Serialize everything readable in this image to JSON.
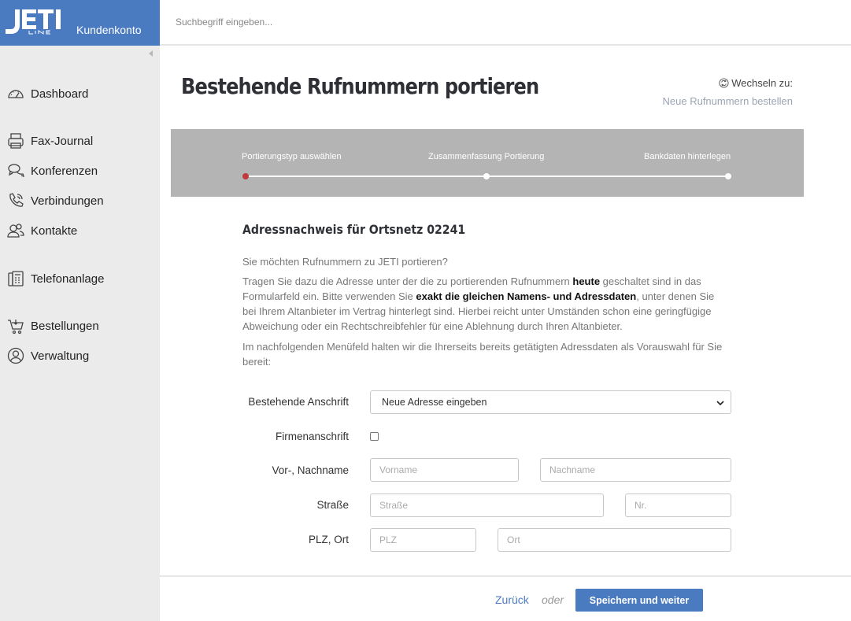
{
  "brand": {
    "logo_text": "JETI LINE",
    "label": "Kundenkonto",
    "color": "#4a7bc1"
  },
  "search": {
    "placeholder": "Suchbegriff eingeben..."
  },
  "sidebar": {
    "items": [
      {
        "label": "Dashboard",
        "icon": "speedometer-icon"
      },
      {
        "label": "Fax-Journal",
        "icon": "fax-icon"
      },
      {
        "label": "Konferenzen",
        "icon": "chat-bubbles-icon"
      },
      {
        "label": "Verbindungen",
        "icon": "phone-icon"
      },
      {
        "label": "Kontakte",
        "icon": "contacts-icon"
      },
      {
        "label": "Telefonanlage",
        "icon": "phone-system-icon"
      },
      {
        "label": "Bestellungen",
        "icon": "cart-icon"
      },
      {
        "label": "Verwaltung",
        "icon": "user-circle-icon"
      }
    ]
  },
  "page": {
    "title": "Bestehende Rufnummern portieren",
    "switch_label": "Wechseln zu:",
    "switch_link": "Neue Rufnummern bestellen"
  },
  "stepper": {
    "steps": [
      {
        "label": "Portierungstyp auswählen",
        "active": true
      },
      {
        "label": "Zusammenfassung Portierung",
        "active": false
      },
      {
        "label": "Bankdaten hinterlegen",
        "active": false
      }
    ],
    "active_color": "#c0393b"
  },
  "content": {
    "section_title": "Adressnachweis für Ortsnetz 02241",
    "intro": "Sie möchten Rufnummern zu JETI portieren?",
    "para2_a": "Tragen Sie dazu die Adresse unter der die zu portierenden Rufnummern ",
    "para2_b": "heute",
    "para2_c": " geschaltet sind in das Formularfeld ein. Bitte verwenden Sie ",
    "para2_d": "exakt die gleichen Namens- und Adressdaten",
    "para2_e": ", unter denen Sie bei Ihrem Altanbieter im Vertrag hinterlegt sind. Hierbei reicht unter Umständen schon eine geringfügige Abweichung oder ein Rechtschreibfehler für eine Ablehnung durch Ihren Altanbieter.",
    "para3": "Im nachfolgenden Menüfeld halten wir die Ihrerseits bereits getätigten Adressdaten als Vorauswahl für Sie bereit:"
  },
  "form": {
    "address_label": "Bestehende Anschrift",
    "address_selected": "Neue Adresse eingeben",
    "company_label": "Firmenanschrift",
    "company_checked": false,
    "name_label": "Vor-, Nachname",
    "firstname_placeholder": "Vorname",
    "lastname_placeholder": "Nachname",
    "street_label": "Straße",
    "street_placeholder": "Straße",
    "number_placeholder": "Nr.",
    "city_label": "PLZ, Ort",
    "zip_placeholder": "PLZ",
    "city_placeholder": "Ort"
  },
  "footer": {
    "back_label": "Zurück",
    "or_label": "oder",
    "save_label": "Speichern und weiter"
  }
}
